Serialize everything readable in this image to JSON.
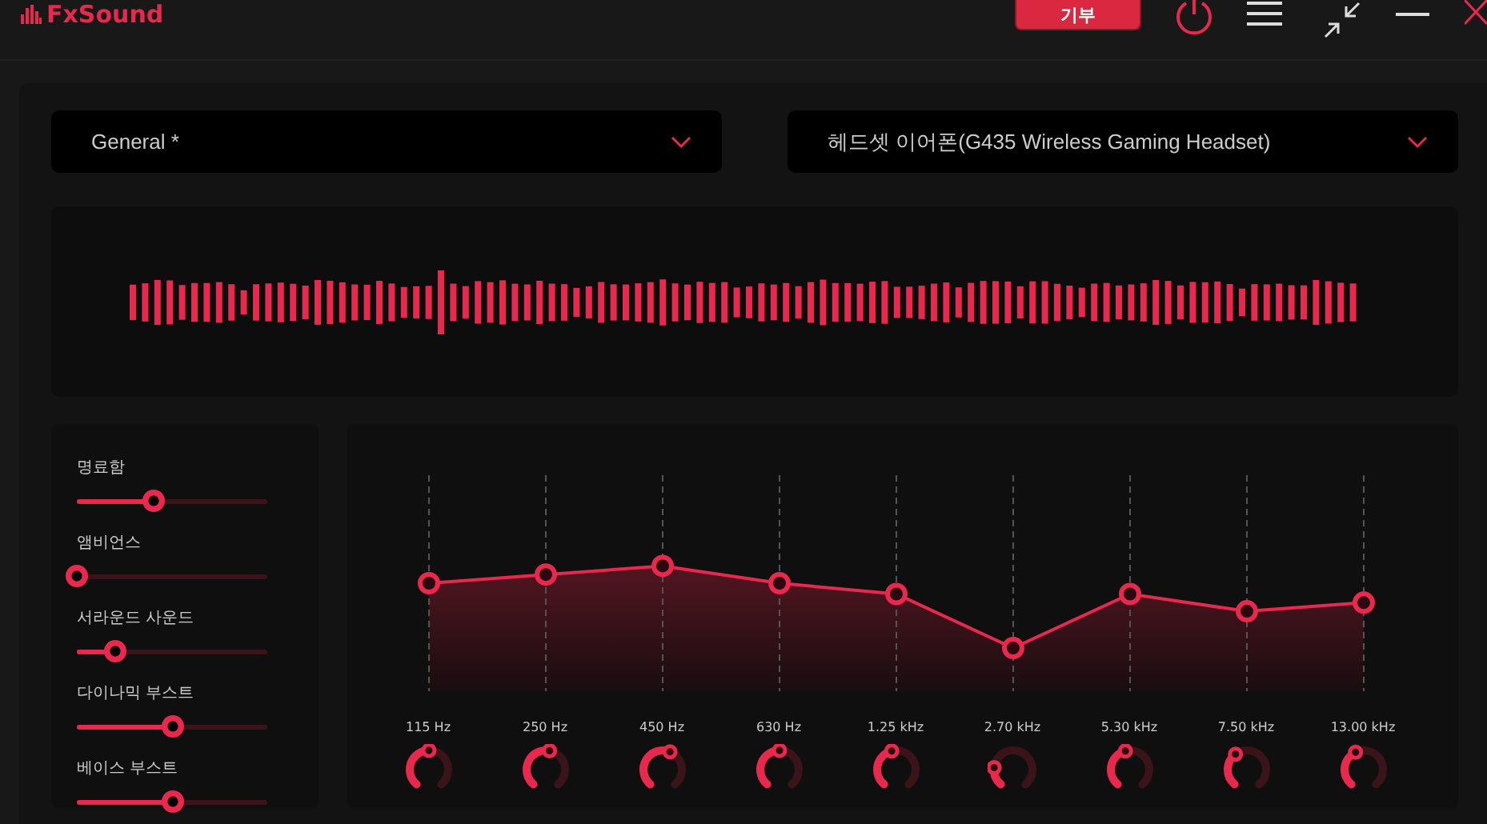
{
  "app": {
    "name": "FxSound"
  },
  "toolbar": {
    "donate_label": "기부"
  },
  "preset": {
    "value": "General *"
  },
  "output_device": {
    "value": "헤드셋 이어폰(G435 Wireless Gaming Headset)"
  },
  "effects": [
    {
      "name": "명료함",
      "level": 0.4
    },
    {
      "name": "앰비언스",
      "level": 0.0
    },
    {
      "name": "서라운드 사운드",
      "level": 0.2
    },
    {
      "name": "다이나믹 부스트",
      "level": 0.5
    },
    {
      "name": "베이스 부스트",
      "level": 0.5
    }
  ],
  "equalizer": {
    "bands": [
      {
        "frequency": "115 Hz",
        "level": 0.5
      },
      {
        "frequency": "250 Hz",
        "level": 0.54
      },
      {
        "frequency": "450 Hz",
        "level": 0.58
      },
      {
        "frequency": "630 Hz",
        "level": 0.5
      },
      {
        "frequency": "1.25 kHz",
        "level": 0.45
      },
      {
        "frequency": "2.70 kHz",
        "level": 0.2
      },
      {
        "frequency": "5.30 kHz",
        "level": 0.45
      },
      {
        "frequency": "7.50 kHz",
        "level": 0.37
      },
      {
        "frequency": "13.00 kHz",
        "level": 0.41
      }
    ]
  }
}
